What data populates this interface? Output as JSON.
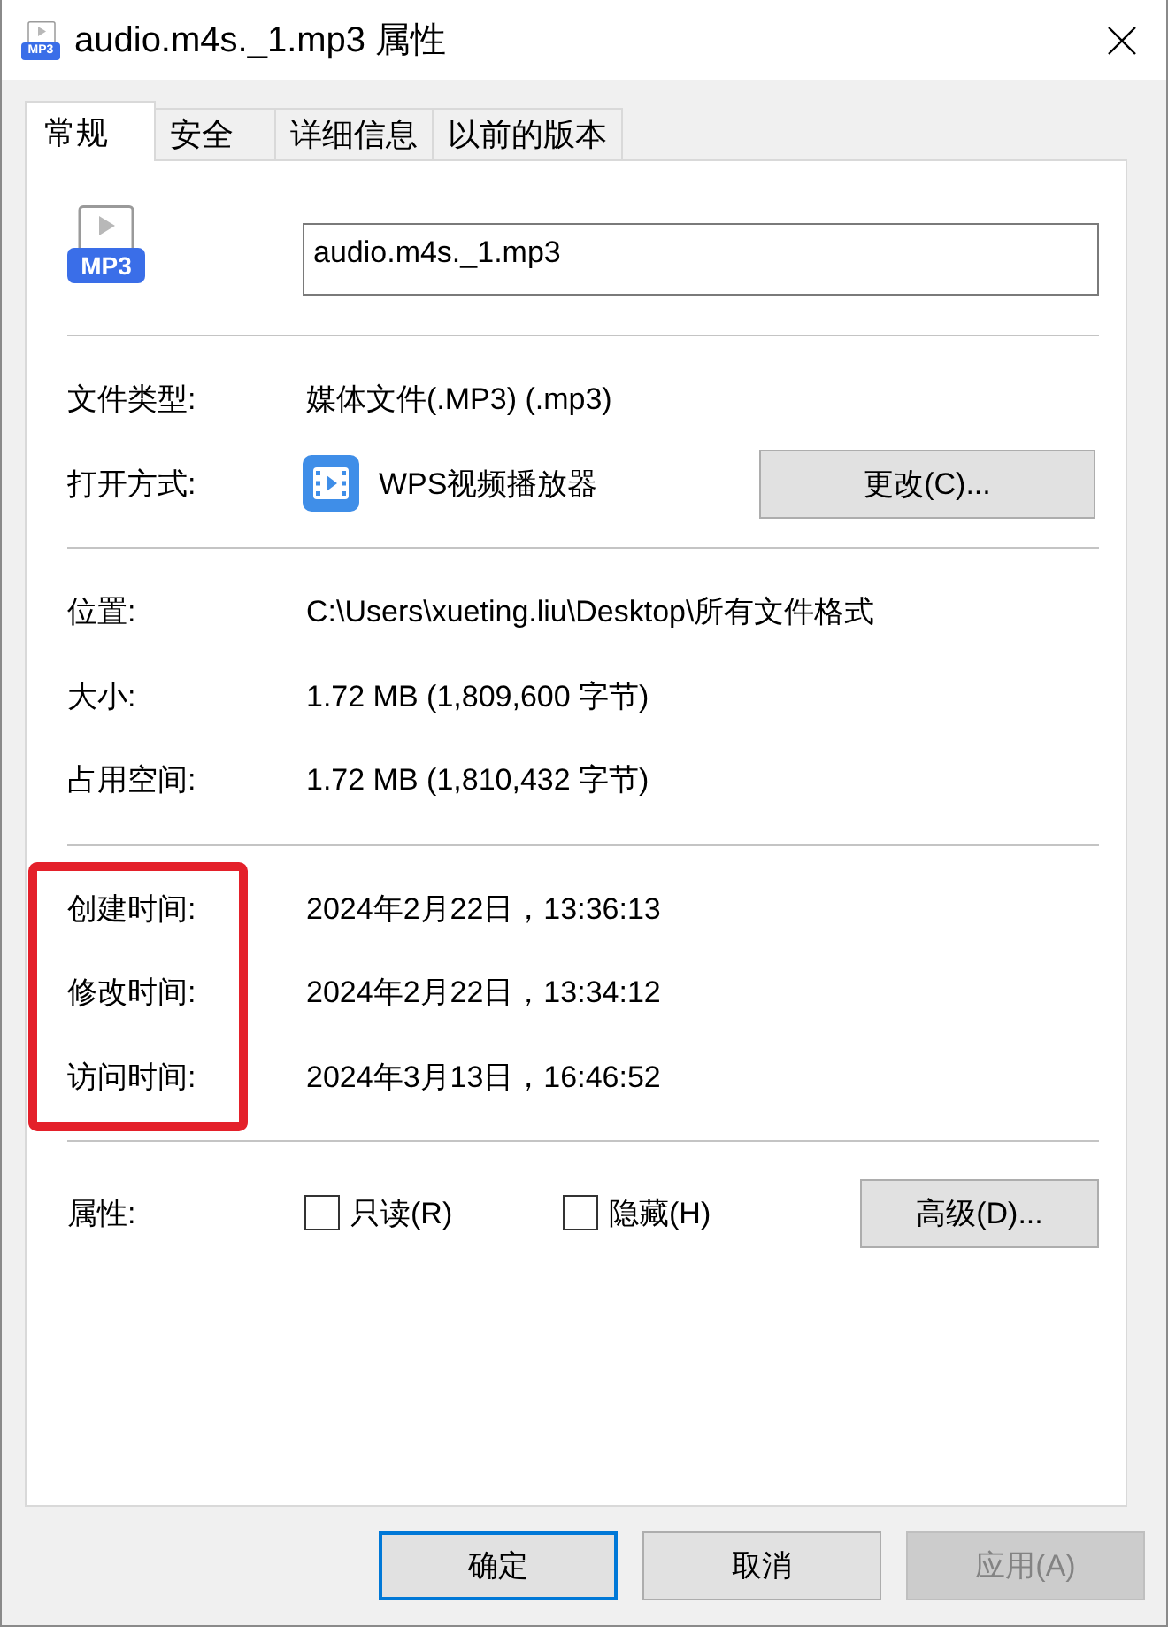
{
  "window": {
    "title": "audio.m4s._1.mp3 属性",
    "icon_label": "MP3"
  },
  "tabs": [
    {
      "label": "常规",
      "selected": true
    },
    {
      "label": "安全",
      "selected": false
    },
    {
      "label": "详细信息",
      "selected": false
    },
    {
      "label": "以前的版本",
      "selected": false
    }
  ],
  "file": {
    "icon_label": "MP3",
    "name": "audio.m4s._1.mp3"
  },
  "sections": [
    {
      "highlighted": false,
      "rows": [
        {
          "kind": "text",
          "label": "文件类型:",
          "value": "媒体文件(.MP3) (.mp3)"
        },
        {
          "kind": "app",
          "label": "打开方式:",
          "value": "WPS视频播放器",
          "button": "更改(C)..."
        }
      ]
    },
    {
      "highlighted": false,
      "rows": [
        {
          "kind": "text",
          "label": "位置:",
          "value": "C:\\Users\\xueting.liu\\Desktop\\所有文件格式"
        },
        {
          "kind": "text",
          "label": "大小:",
          "value": "1.72 MB (1,809,600 字节)"
        },
        {
          "kind": "text",
          "label": "占用空间:",
          "value": "1.72 MB (1,810,432 字节)"
        }
      ]
    },
    {
      "highlighted": true,
      "rows": [
        {
          "kind": "text",
          "label": "创建时间:",
          "value": "2024年2月22日，13:36:13"
        },
        {
          "kind": "text",
          "label": "修改时间:",
          "value": "2024年2月22日，13:34:12"
        },
        {
          "kind": "text",
          "label": "访问时间:",
          "value": "2024年3月13日，16:46:52"
        }
      ]
    },
    {
      "highlighted": false,
      "rows": [
        {
          "kind": "attributes",
          "label": "属性:",
          "checkboxes": [
            {
              "label": "只读(R)",
              "checked": false
            },
            {
              "label": "隐藏(H)",
              "checked": false
            }
          ],
          "button": "高级(D)..."
        }
      ]
    }
  ],
  "buttons": [
    {
      "label": "确定",
      "default": true,
      "disabled": false
    },
    {
      "label": "取消",
      "default": false,
      "disabled": false
    },
    {
      "label": "应用(A)",
      "default": false,
      "disabled": true
    }
  ]
}
